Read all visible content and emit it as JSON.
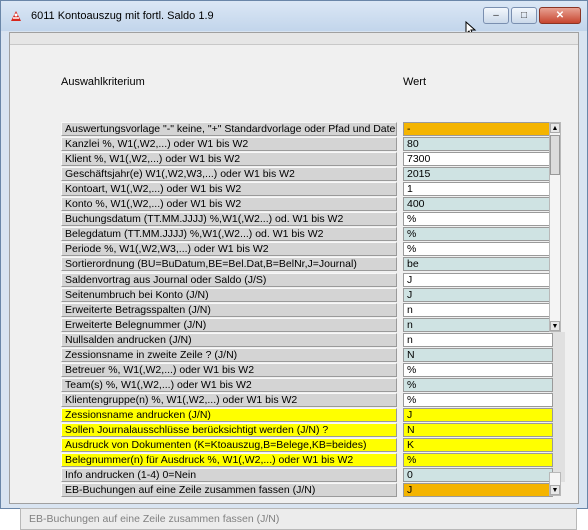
{
  "window": {
    "title": "6011 Kontoauszug mit fortl. Saldo 1.9",
    "minimize_glyph": "–",
    "maximize_glyph": "□",
    "close_glyph": "✕"
  },
  "grid": {
    "header_kriterium": "Auswahlkriterium",
    "header_wert": "Wert",
    "rows": [
      {
        "label": "Auswertungsvorlage \"-\" keine, \"+\" Standardvorlage oder Pfad und Dateiname",
        "value": "-"
      },
      {
        "label": "Kanzlei  %, W1(,W2,...) oder W1 bis W2",
        "value": "80"
      },
      {
        "label": "Klient  %, W1(,W2,...) oder W1 bis W2",
        "value": "7300"
      },
      {
        "label": "Geschäftsjahr(e)  W1(,W2,W3,...) oder W1 bis W2",
        "value": "2015"
      },
      {
        "label": "Kontoart, W1(,W2,...) oder W1 bis W2",
        "value": "1"
      },
      {
        "label": "Konto  %, W1(,W2,...) oder W1 bis W2",
        "value": "400"
      },
      {
        "label": "Buchungsdatum (TT.MM.JJJJ) %,W1(,W2...) od. W1 bis W2",
        "value": "%"
      },
      {
        "label": "Belegdatum  (TT.MM.JJJJ) %,W1(,W2...) od. W1 bis W2",
        "value": "%"
      },
      {
        "label": "Periode  %, W1(,W2,W3,...) oder W1 bis W2",
        "value": "%"
      },
      {
        "label": "Sortierordnung (BU=BuDatum,BE=Bel.Dat,B=BelNr,J=Journal)",
        "value": "be"
      },
      {
        "label": "Saldenvortrag aus Journal oder Saldo (J/S)",
        "value": "J"
      },
      {
        "label": "Seitenumbruch bei Konto (J/N)",
        "value": "J"
      },
      {
        "label": "Erweiterte Betragsspalten (J/N)",
        "value": "n"
      },
      {
        "label": "Erweiterte Belegnummer (J/N)",
        "value": "n"
      },
      {
        "label": "Nullsalden andrucken (J/N)",
        "value": "n"
      },
      {
        "label": "Zessionsname in zweite Zeile ? (J/N)",
        "value": "N"
      },
      {
        "label": "Betreuer  %, W1(,W2,...) oder W1 bis W2",
        "value": "%"
      },
      {
        "label": "Team(s)  %, W1(,W2,...) oder W1 bis W2",
        "value": "%"
      },
      {
        "label": "Klientengruppe(n)  %, W1(,W2,...) oder W1 bis W2",
        "value": "%"
      },
      {
        "label": "Zessionsname andrucken (J/N)",
        "value": "J"
      },
      {
        "label": "Sollen Journalausschlüsse berücksichtigt werden (J/N) ?",
        "value": "N"
      },
      {
        "label": "Ausdruck von Dokumenten (K=Ktoauszug,B=Belege,KB=beides)",
        "value": "K"
      },
      {
        "label": "Belegnummer(n) für Ausdruck  %, W1(,W2,...) oder W1 bis W2",
        "value": "%"
      },
      {
        "label": "Info andrucken (1-4) 0=Nein",
        "value": "0"
      },
      {
        "label": "EB-Buchungen auf eine Zeile zusammen fassen (J/N)",
        "value": "J"
      }
    ]
  },
  "statusbar": {
    "text": "EB-Buchungen auf eine Zeile zusammen fassen (J/N)"
  },
  "scrollbar": {
    "up_glyph": "▲",
    "down_glyph": "▼"
  },
  "colors": {
    "highlight_yellow": "#ffff00",
    "active_orange": "#f4b400",
    "alt_row": "#cfe3e3"
  }
}
